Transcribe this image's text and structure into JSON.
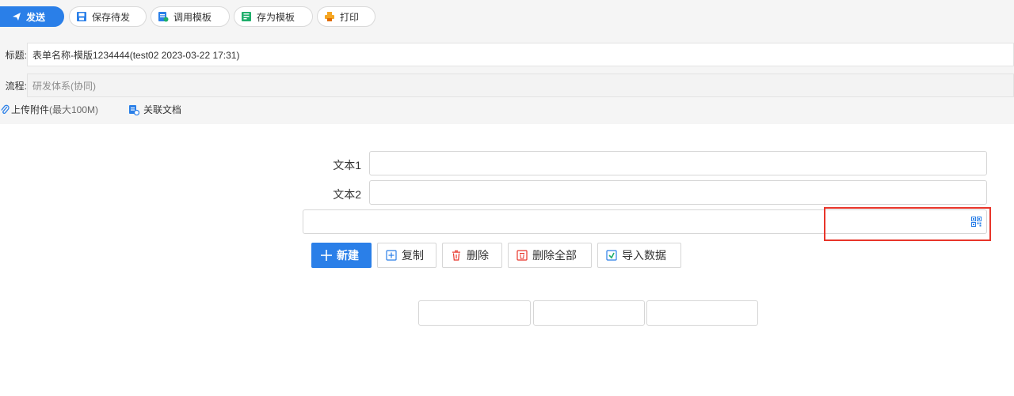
{
  "toolbar": {
    "send_label": "发送",
    "save_draft_label": "保存待发",
    "use_template_label": "调用模板",
    "save_template_label": "存为模板",
    "print_label": "打印"
  },
  "header": {
    "title_label": "标题:",
    "title_value": "表单名称-模版1234444(test02 2023-03-22 17:31)",
    "flow_label": "流程:",
    "flow_value": "研发体系(协同)",
    "attach_label": "上传附件",
    "attach_limit": "(最大100M)",
    "related_doc_label": "关联文档"
  },
  "form": {
    "field1_label": "文本1",
    "field2_label": "文本2",
    "field1_value": "",
    "field2_value": "",
    "field3_value": ""
  },
  "actions": {
    "new_label": "新建",
    "copy_label": "复制",
    "delete_label": "删除",
    "delete_all_label": "删除全部",
    "import_label": "导入数据"
  },
  "colors": {
    "accent": "#2a7fe8",
    "highlight": "#e8352a"
  },
  "icons": [
    "send-icon",
    "save-icon",
    "template-icon",
    "save-template-icon",
    "print-icon",
    "paperclip-icon",
    "document-link-icon",
    "qrcode-icon",
    "plus-icon",
    "copy-icon",
    "trash-icon",
    "trash-all-icon",
    "import-icon"
  ]
}
